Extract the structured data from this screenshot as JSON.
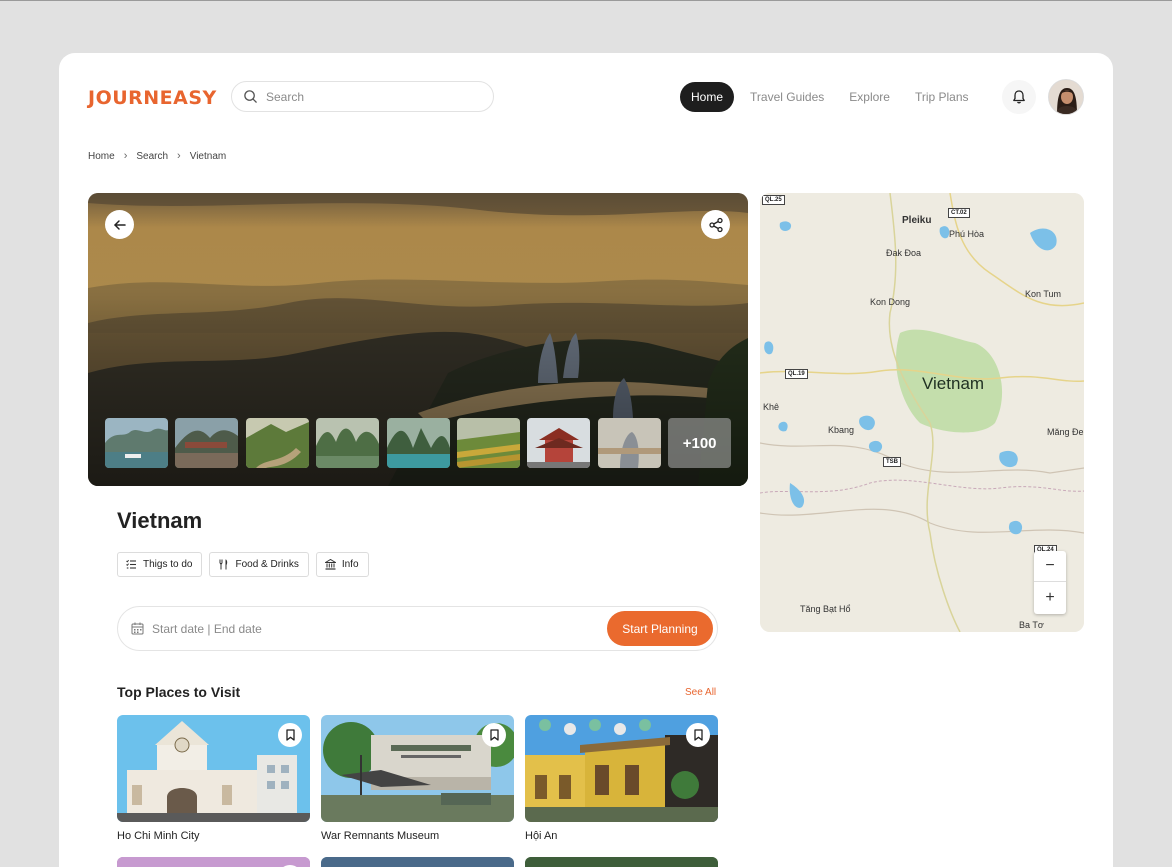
{
  "app": {
    "logo": "JOURNEASY"
  },
  "search": {
    "placeholder": "Search",
    "icon": "search-icon"
  },
  "nav": [
    {
      "label": "Home",
      "active": true
    },
    {
      "label": "Travel Guides",
      "active": false
    },
    {
      "label": "Explore",
      "active": false
    },
    {
      "label": "Trip Plans",
      "active": false
    }
  ],
  "breadcrumb": [
    "Home",
    "Search",
    "Vietnam"
  ],
  "hero": {
    "more_photos": "+100",
    "thumbnail_count": 9
  },
  "map": {
    "country_label": "Vietnam",
    "labels": [
      "Pleiku",
      "Phú Hòa",
      "Đak Đoa",
      "Kon Dong",
      "Kon Tum",
      "Khê",
      "Kbang",
      "Măng Đe",
      "Tăng Bạt Hổ",
      "Ba Tơ"
    ],
    "route_shields": [
      "QL.25",
      "CT.02",
      "QL.19",
      "TSB",
      "QL.24"
    ],
    "zoom_in": "+",
    "zoom_out": "−"
  },
  "place": {
    "title": "Vietnam",
    "chips": [
      {
        "label": "Thigs to do",
        "icon": "list-icon"
      },
      {
        "label": "Food & Drinks",
        "icon": "utensils-icon"
      },
      {
        "label": "Info",
        "icon": "bank-icon"
      }
    ]
  },
  "planner": {
    "date_placeholder": "Start date | End date",
    "button": "Start Planning"
  },
  "top_places": {
    "title": "Top Places to Visit",
    "see_all": "See All",
    "items": [
      {
        "name": "Ho Chi Minh City"
      },
      {
        "name": "War Remnants Museum"
      },
      {
        "name": "Hội An"
      }
    ]
  },
  "colors": {
    "accent": "#e8652f",
    "button": "#ea6a2e",
    "nav_active": "#1e1e1e"
  }
}
